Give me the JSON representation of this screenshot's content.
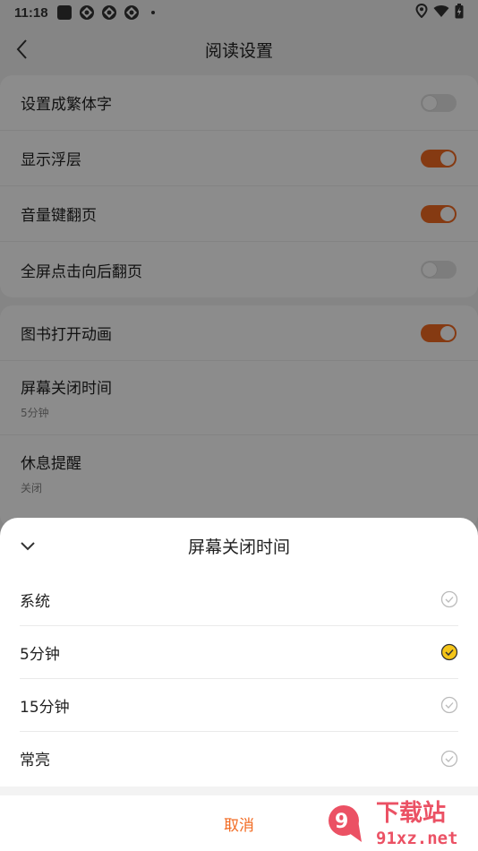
{
  "status_bar": {
    "time": "11:18"
  },
  "nav": {
    "title": "阅读设置"
  },
  "settings_group1": [
    {
      "label": "设置成繁体字",
      "enabled": false
    },
    {
      "label": "显示浮层",
      "enabled": true
    },
    {
      "label": "音量键翻页",
      "enabled": true
    },
    {
      "label": "全屏点击向后翻页",
      "enabled": false
    }
  ],
  "settings_group2": {
    "book_animation": {
      "label": "图书打开动画",
      "enabled": true
    },
    "screen_off": {
      "label": "屏幕关闭时间",
      "value": "5分钟"
    },
    "rest_reminder": {
      "label": "休息提醒",
      "value": "关闭"
    }
  },
  "sheet": {
    "title": "屏幕关闭时间",
    "options": [
      {
        "label": "系统",
        "selected": false
      },
      {
        "label": "5分钟",
        "selected": true
      },
      {
        "label": "15分钟",
        "selected": false
      },
      {
        "label": "常亮",
        "selected": false
      }
    ],
    "cancel_label": "取消"
  },
  "watermark": {
    "line1": "下载站",
    "line2": "91xz.net"
  },
  "colors": {
    "accent": "#f26a21",
    "selected_check": "#f5c518"
  }
}
